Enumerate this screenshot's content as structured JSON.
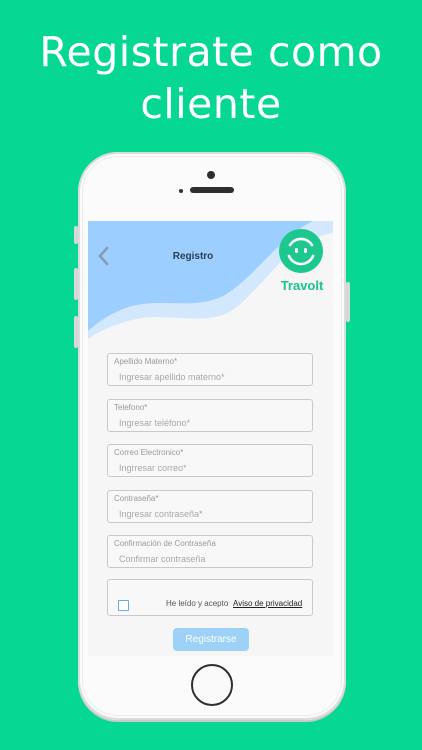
{
  "headline": {
    "line1": "Registrate como",
    "line2": "cliente"
  },
  "colors": {
    "background": "#06d894",
    "brand": "#18c48a",
    "header_blue": "#9ccfff",
    "button": "#9dd1f7"
  },
  "header": {
    "back_icon": "chevron-left-icon",
    "title": "Registro"
  },
  "brand": {
    "logo_icon": "smile-face-icon",
    "name": "Travolt"
  },
  "form": {
    "fields": [
      {
        "label": "Apellido Materno*",
        "placeholder": "Ingresar apellido materno*",
        "value": ""
      },
      {
        "label": "Telefono*",
        "placeholder": "Ingresar teléfono*",
        "value": ""
      },
      {
        "label": "Correo Electronico*",
        "placeholder": "Ingrresar correo*",
        "value": ""
      },
      {
        "label": "Contraseña*",
        "placeholder": "Ingresar contraseña*",
        "value": ""
      },
      {
        "label": "Confirmación de Contraseña",
        "placeholder": "Confirmar contraseña",
        "value": ""
      }
    ],
    "terms_text": "He leído y acepto",
    "privacy_link": "Aviso de privacidad",
    "submit_label": "Registrarse"
  }
}
